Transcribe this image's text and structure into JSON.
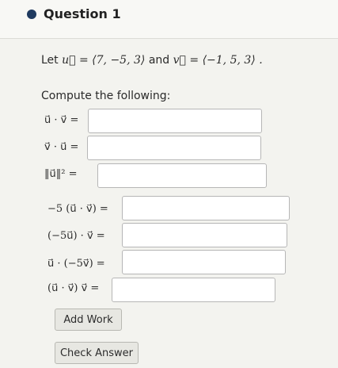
{
  "header": {
    "question_title": "Question 1"
  },
  "problem": {
    "let_label": "Let",
    "u_vector": "⟨7, −5, 3⟩",
    "and_label": "and",
    "v_vector": "⟨−1, 5, 3⟩"
  },
  "instructions": "Compute the following:",
  "expressions": [
    "u⃗ · v⃗ =",
    "v⃗ · u⃗ =",
    "‖u⃗‖² =",
    "−5 (u⃗ · v⃗) =",
    "(−5u⃗) · v⃗ =",
    "u⃗ · (−5v⃗) =",
    "(u⃗ · v⃗) v⃗ ="
  ],
  "answers": [
    "",
    "",
    "",
    "",
    "",
    "",
    ""
  ],
  "buttons": {
    "add_work": "Add Work",
    "check_answer": "Check Answer"
  }
}
